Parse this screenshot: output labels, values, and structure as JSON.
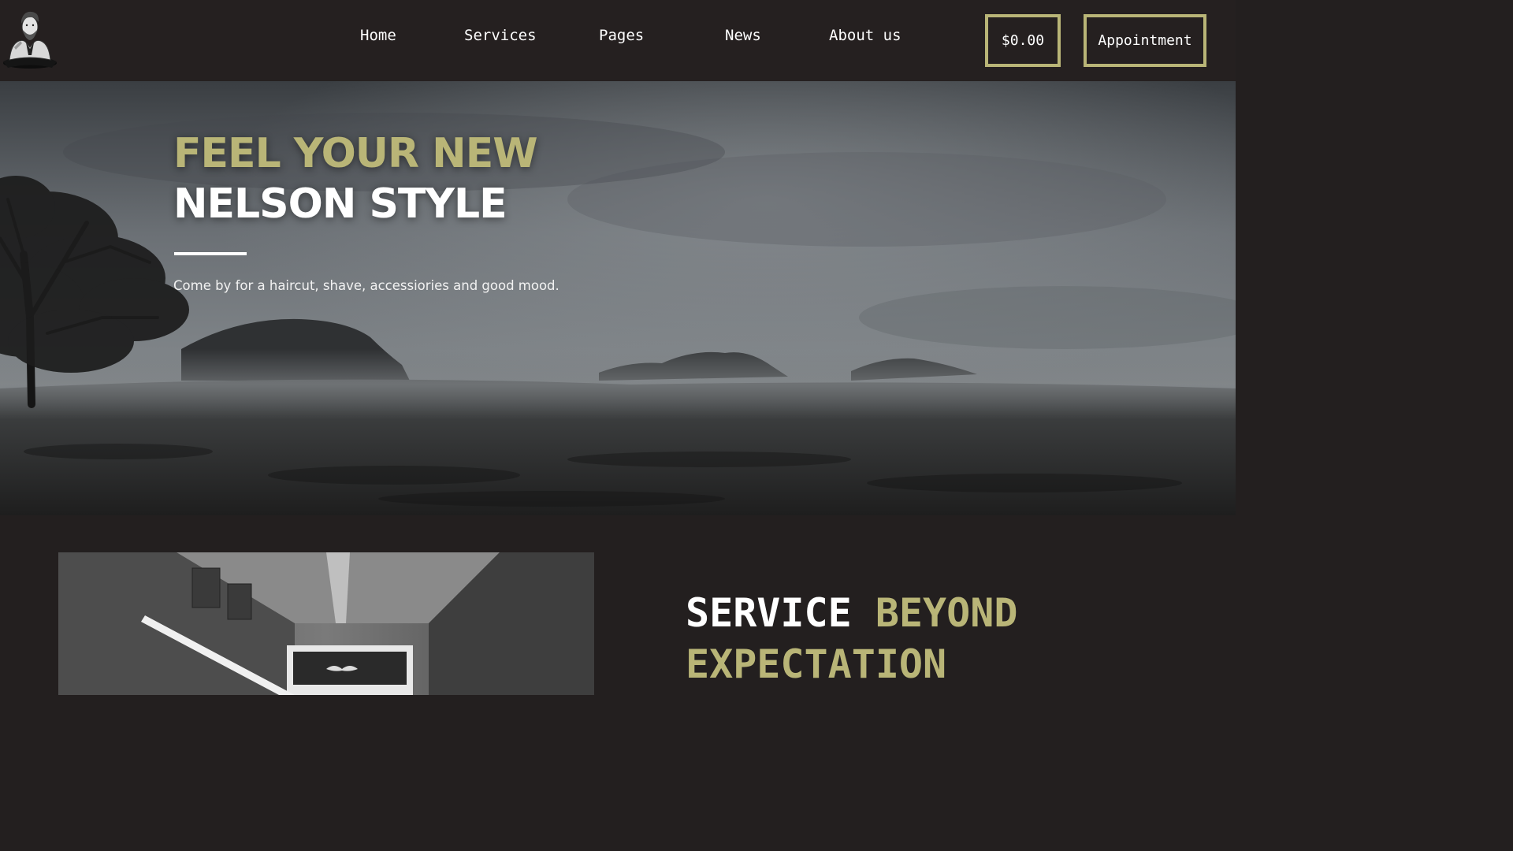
{
  "header": {
    "logo": "barber-man-logo",
    "nav": [
      {
        "label": "Home"
      },
      {
        "label": "Services"
      },
      {
        "label": "Pages"
      },
      {
        "label": "News"
      },
      {
        "label": "About us"
      }
    ],
    "cart_label": "$0.00",
    "appointment_label": "Appointment"
  },
  "hero": {
    "title_line1": "FEEL YOUR NEW",
    "title_line2": "NELSON STYLE",
    "subtitle": "Come by for a haircut, shave, accessiories and good mood."
  },
  "section": {
    "heading_part1": "SERVICE",
    "heading_part2": "BEYOND",
    "heading_line2": "EXPECTATION"
  },
  "colors": {
    "accent": "#b9b577",
    "background": "#231f1f",
    "text": "#ffffff"
  }
}
